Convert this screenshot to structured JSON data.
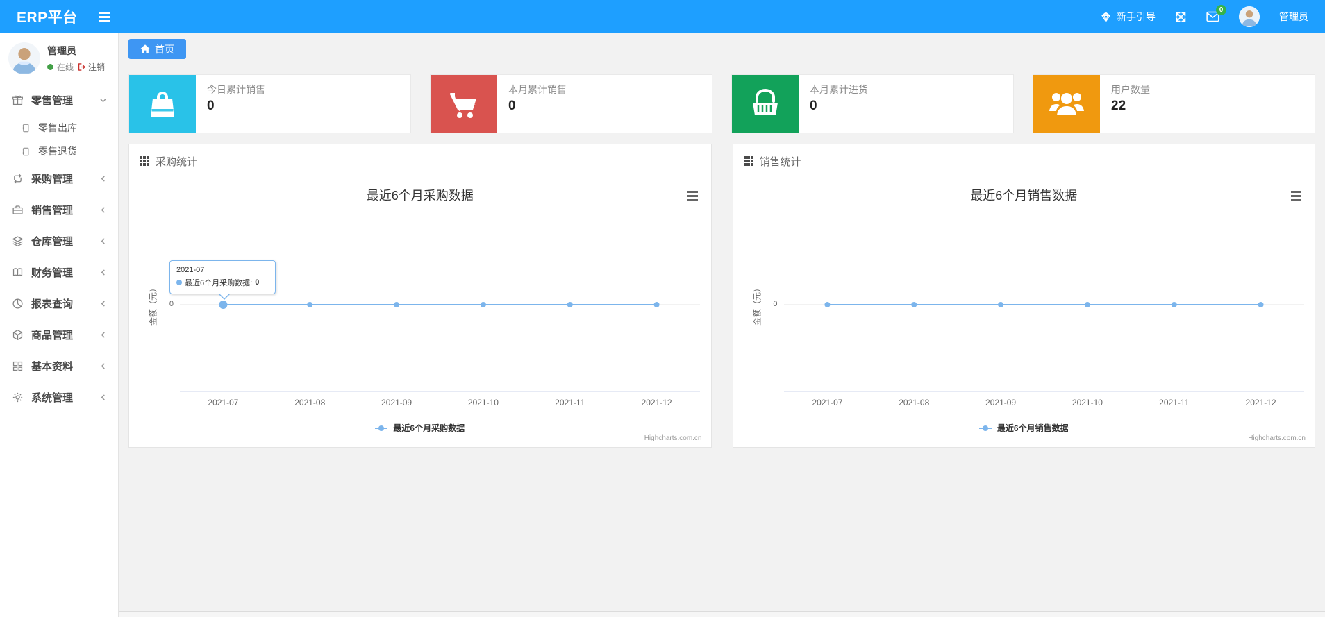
{
  "colors": {
    "navbar": "#1e9fff",
    "tab": "#3e96f3",
    "chart_line": "#7cb5ec",
    "badge_green": "#36b34a"
  },
  "navbar": {
    "brand": "ERP平台",
    "guide_label": "新手引导",
    "message_badge": "0",
    "user_name": "管理员"
  },
  "sidebar": {
    "user": {
      "name": "管理员",
      "status_online": "在线",
      "logout_label": "注销"
    },
    "menu": [
      {
        "label": "零售管理",
        "expanded": true,
        "children": [
          {
            "label": "零售出库"
          },
          {
            "label": "零售退货"
          }
        ]
      },
      {
        "label": "采购管理"
      },
      {
        "label": "销售管理"
      },
      {
        "label": "仓库管理"
      },
      {
        "label": "财务管理"
      },
      {
        "label": "报表查询"
      },
      {
        "label": "商品管理"
      },
      {
        "label": "基本资料"
      },
      {
        "label": "系统管理"
      }
    ]
  },
  "home_tab": {
    "label": "首页"
  },
  "stat_cards": [
    {
      "title": "今日累计销售",
      "value": "0",
      "color": "#29c2e8",
      "icon": "shopping-bag-icon"
    },
    {
      "title": "本月累计销售",
      "value": "0",
      "color": "#d9534f",
      "icon": "shopping-cart-icon"
    },
    {
      "title": "本月累计进货",
      "value": "0",
      "color": "#12a25a",
      "icon": "shopping-basket-icon"
    },
    {
      "title": "用户数量",
      "value": "22",
      "color": "#f0990f",
      "icon": "users-icon"
    }
  ],
  "panels": [
    {
      "header": "采购统计"
    },
    {
      "header": "销售统计"
    }
  ],
  "chart_data": [
    {
      "type": "line",
      "title": "最近6个月采购数据",
      "categories": [
        "2021-07",
        "2021-08",
        "2021-09",
        "2021-10",
        "2021-11",
        "2021-12"
      ],
      "series": [
        {
          "name": "最近6个月采购数据",
          "values": [
            0,
            0,
            0,
            0,
            0,
            0
          ]
        }
      ],
      "ylabel": "金额（元）",
      "yticks": [
        0
      ],
      "ylim": [
        0,
        0
      ],
      "grid": true,
      "legend_position": "bottom",
      "line_color": "#7cb5ec",
      "credit": "Highcharts.com.cn",
      "tooltip": {
        "visible": true,
        "point_index": 0,
        "header": "2021-07",
        "label": "最近6个月采购数据:",
        "value": "0"
      }
    },
    {
      "type": "line",
      "title": "最近6个月销售数据",
      "categories": [
        "2021-07",
        "2021-08",
        "2021-09",
        "2021-10",
        "2021-11",
        "2021-12"
      ],
      "series": [
        {
          "name": "最近6个月销售数据",
          "values": [
            0,
            0,
            0,
            0,
            0,
            0
          ]
        }
      ],
      "ylabel": "金额（元）",
      "yticks": [
        0
      ],
      "ylim": [
        0,
        0
      ],
      "grid": true,
      "legend_position": "bottom",
      "line_color": "#7cb5ec",
      "credit": "Highcharts.com.cn",
      "tooltip": {
        "visible": false
      }
    }
  ]
}
